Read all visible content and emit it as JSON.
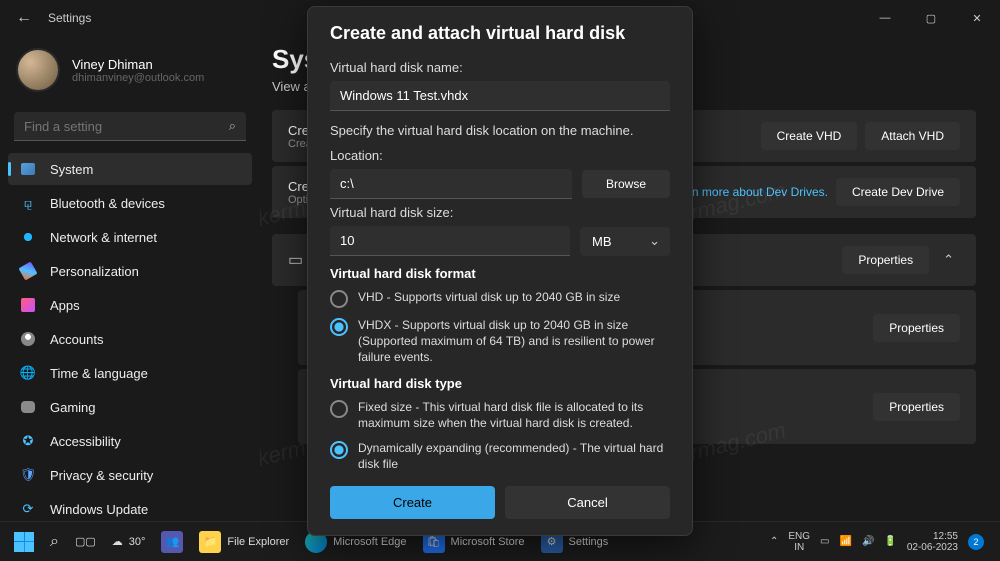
{
  "titlebar": {
    "title": "Settings"
  },
  "profile": {
    "name": "Viney Dhiman",
    "email": "dhimanviney@outlook.com"
  },
  "search": {
    "placeholder": "Find a setting"
  },
  "nav": [
    {
      "label": "System",
      "active": true
    },
    {
      "label": "Bluetooth & devices"
    },
    {
      "label": "Network & internet"
    },
    {
      "label": "Personalization"
    },
    {
      "label": "Apps"
    },
    {
      "label": "Accounts"
    },
    {
      "label": "Time & language"
    },
    {
      "label": "Gaming"
    },
    {
      "label": "Accessibility"
    },
    {
      "label": "Privacy & security"
    },
    {
      "label": "Windows Update"
    }
  ],
  "main": {
    "title": "Syste",
    "subtitle": "View and n",
    "cards": {
      "c1_title": "Create a",
      "c1_desc": "Create an",
      "c2_title": "Create a",
      "c2_desc": "Optimize",
      "btn_vhd": "Create VHD",
      "btn_attach": "Attach VHD",
      "btn_devdrive": "Create Dev Drive",
      "link_learn": "Learn more about Dev Drives.",
      "btn_props": "Properties"
    }
  },
  "dialog": {
    "title": "Create and attach virtual hard disk",
    "label_name": "Virtual hard disk name:",
    "val_name": "Windows 11 Test.vhdx",
    "help_loc": "Specify the virtual hard disk location on the machine.",
    "label_loc": "Location:",
    "val_loc": "c:\\",
    "btn_browse": "Browse",
    "label_size": "Virtual hard disk size:",
    "val_size": "10",
    "unit": "MB",
    "sec_format": "Virtual hard disk format",
    "opt_vhd": "VHD - Supports virtual disk up to 2040 GB in size",
    "opt_vhdx": "VHDX - Supports virtual disk up to 2040 GB in size (Supported maximum of 64 TB) and is resilient to power failure events.",
    "sec_type": "Virtual hard disk type",
    "opt_fixed": "Fixed size - This virtual hard disk file is allocated to its maximum size when the virtual hard disk is created.",
    "opt_dyn": "Dynamically expanding (recommended) - The virtual hard disk file",
    "btn_create": "Create",
    "btn_cancel": "Cancel"
  },
  "taskbar": {
    "weather_temp": "30°",
    "items": [
      "File Explorer",
      "Microsoft Edge",
      "Microsoft Store",
      "Settings"
    ],
    "lang1": "ENG",
    "lang2": "IN",
    "time": "12:55",
    "date": "02-06-2023",
    "notif": "2"
  },
  "watermark": "geekermag.com"
}
